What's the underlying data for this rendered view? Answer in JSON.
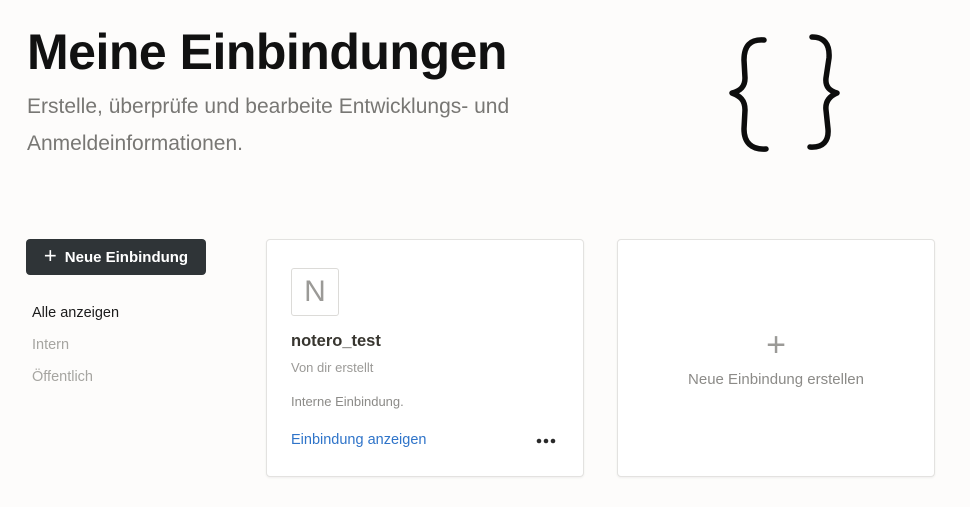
{
  "header": {
    "title": "Meine Einbindungen",
    "subtitle": "Erstelle, überprüfe und bearbeite Entwicklungs- und Anmeldeinformationen.",
    "illustration_icon": "curly-braces-icon"
  },
  "sidebar": {
    "new_button": {
      "icon": "plus-icon",
      "label": "Neue Einbindung"
    },
    "filters": [
      {
        "label": "Alle anzeigen",
        "active": true
      },
      {
        "label": "Intern",
        "active": false
      },
      {
        "label": "Öffentlich",
        "active": false
      }
    ]
  },
  "integrations": [
    {
      "icon_letter": "N",
      "name": "notero_test",
      "creator": "Von dir erstellt",
      "type": "Interne Einbindung.",
      "link_label": "Einbindung anzeigen",
      "more_icon": "more-horizontal-icon"
    }
  ],
  "new_card": {
    "plus": "+",
    "label": "Neue Einbindung erstellen"
  },
  "colors": {
    "background": "#fdfcfb",
    "button_bg": "#2f3437",
    "link": "#2f74c9",
    "muted": "#9b9a97"
  }
}
